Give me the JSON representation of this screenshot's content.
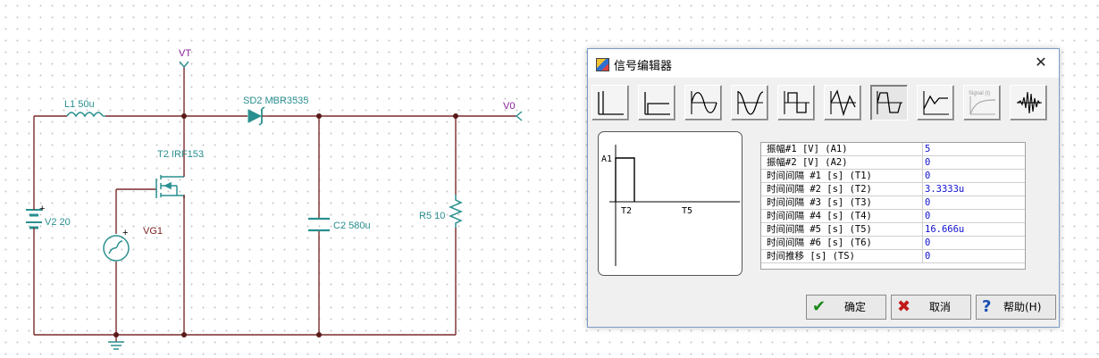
{
  "schematic": {
    "labels": {
      "vt": "VT",
      "v0": "V0",
      "l1": "L1 50u",
      "sd2": "SD2 MBR3535",
      "t2": "T2 IRF153",
      "v2": "V2 20",
      "vg1": "VG1",
      "c2": "C2 580u",
      "r5": "R5 10",
      "plus_v2": "+",
      "plus_vg1": "+"
    },
    "colors": {
      "wire": "#7a2a2a",
      "node": "#5a1a1a",
      "teal": "#2a8f8f",
      "purple": "#8a1f9a",
      "ground": "#2a8f8f"
    }
  },
  "dialog": {
    "title": "信号编辑器",
    "close_glyph": "✕",
    "toolbar": [
      {
        "name": "unit-step"
      },
      {
        "name": "unit-step-delayed"
      },
      {
        "name": "sine"
      },
      {
        "name": "cosine"
      },
      {
        "name": "square"
      },
      {
        "name": "damped-sine"
      },
      {
        "name": "pulse-trapezoid"
      },
      {
        "name": "triangle-general"
      },
      {
        "name": "signal-t-general",
        "label": "Signal (t)",
        "disabled": true
      },
      {
        "name": "chirp-burst"
      }
    ],
    "preview": {
      "a1": "A1",
      "t2": "T2",
      "t5": "T5"
    },
    "params": [
      {
        "name": "振幅#1 [V] (A1)",
        "value": "5"
      },
      {
        "name": "振幅#2 [V] (A2)",
        "value": "0"
      },
      {
        "name": "时间间隔 #1 [s] (T1)",
        "value": "0"
      },
      {
        "name": "时间间隔 #2 [s] (T2)",
        "value": "3.3333u"
      },
      {
        "name": "时间间隔 #3 [s] (T3)",
        "value": "0"
      },
      {
        "name": "时间间隔 #4 [s] (T4)",
        "value": "0"
      },
      {
        "name": "时间间隔 #5 [s] (T5)",
        "value": "16.666u"
      },
      {
        "name": "时间间隔 #6 [s] (T6)",
        "value": "0"
      },
      {
        "name": "时间推移 [s] (TS)",
        "value": "0"
      }
    ],
    "buttons": {
      "ok_label": "确定",
      "ok_icon": "✔",
      "cancel_label": "取消",
      "cancel_icon": "✖",
      "help_label": "帮助(H)",
      "help_icon": "?"
    }
  }
}
